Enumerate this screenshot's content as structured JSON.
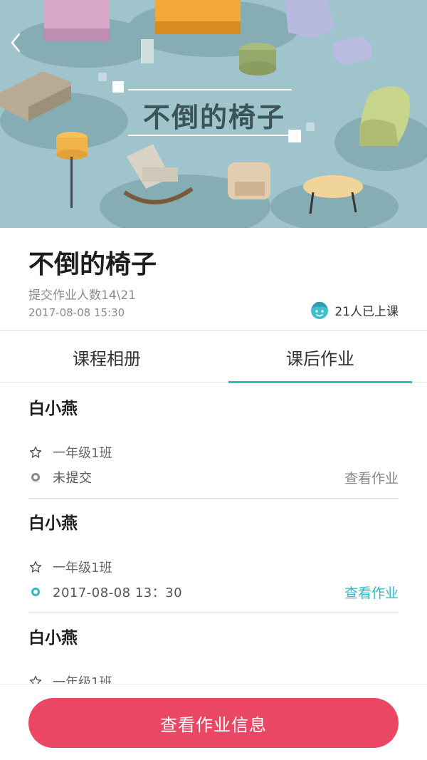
{
  "banner": {
    "title": "不倒的椅子"
  },
  "course": {
    "title": "不倒的椅子",
    "submit_count": "提交作业人数14\\21",
    "time": "2017-08-08 15:30",
    "attend_text": "21人已上课"
  },
  "tabs": [
    {
      "label": "课程相册",
      "active": false
    },
    {
      "label": "课后作业",
      "active": true
    }
  ],
  "homework": [
    {
      "name": "白小燕",
      "class": "一年级1班",
      "status": "未提交",
      "link": "查看作业"
    },
    {
      "name": "白小燕",
      "class": "一年级1班",
      "status": "2017-08-08 13：30",
      "link": "查看作业"
    },
    {
      "name": "白小燕",
      "class": "一年级1班"
    }
  ],
  "bottom_button": "查看作业信息",
  "colors": {
    "accent": "#33b8c4",
    "primary_button": "#e94764",
    "muted_text": "#8a8a8a",
    "link_gray": "#888888"
  },
  "icons": [
    "back-arrow-icon",
    "child-face-icon",
    "star-outline-icon",
    "status-circle-icon"
  ]
}
